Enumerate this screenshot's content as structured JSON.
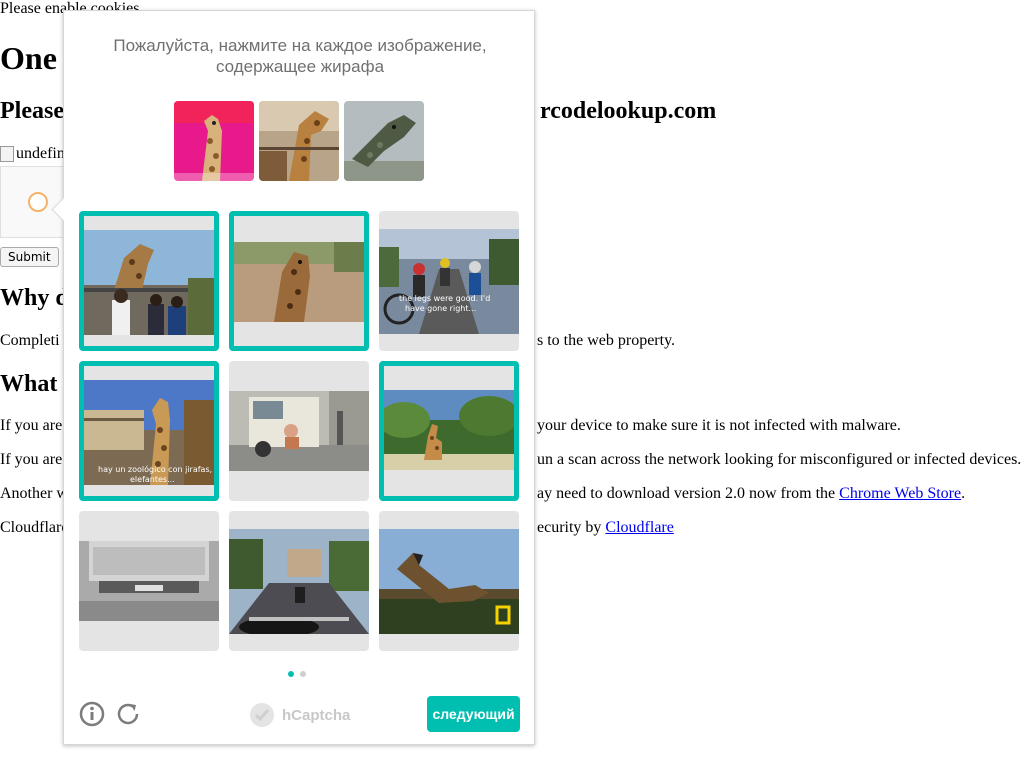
{
  "background_page": {
    "cookie_notice": "Please enable cookies.",
    "heading_one": "One",
    "heading_please": "Please",
    "heading_domain": "rcodelookup.com",
    "broken_image_alt": "undefin",
    "submit_label": "Submit",
    "heading_why": "Why d",
    "completing_start": "Completi",
    "completing_end": "s to the web property.",
    "heading_what": "What",
    "if_you_are_1_start": "If you are",
    "if_you_are_1_end": "your device to make sure it is not infected with malware.",
    "if_you_are_2_start": "If you are",
    "if_you_are_2_end": "un a scan across the network looking for misconfigured or infected devices.",
    "another_start": "Another w",
    "another_end": "ay need to download version 2.0 now from the",
    "chrome_store_link": "Chrome Web Store",
    "period": ".",
    "cloudflare_start": "Cloudflare",
    "cloudflare_end": "ecurity by",
    "cloudflare_link": "Cloudflare"
  },
  "challenge": {
    "prompt": "Пожалуйста, нажмите на каждое изображение, содержащее жирафа",
    "example_images": [
      "giraffe-pink-background",
      "giraffe-at-fence",
      "giraffe-head-close"
    ],
    "grid": [
      {
        "subject": "giraffe-feeding-crowd",
        "selected": true
      },
      {
        "subject": "giraffe-head-dirt",
        "selected": true
      },
      {
        "subject": "cyclists-road",
        "selected": false,
        "caption": "the legs were good. I'd have gone right..."
      },
      {
        "subject": "giraffe-enclosure",
        "selected": true,
        "caption": "hay un zoológico con jirafas, elefantes..."
      },
      {
        "subject": "garbage-truck-street",
        "selected": false
      },
      {
        "subject": "giraffe-trees",
        "selected": true
      },
      {
        "subject": "truck-rear",
        "selected": false
      },
      {
        "subject": "motorcycle-street",
        "selected": false
      },
      {
        "subject": "giraffe-head-sky",
        "selected": false
      }
    ],
    "page_dots": [
      true,
      false
    ],
    "brand": "hCaptcha",
    "next_label": "следующий",
    "accent_color": "#00bfb0"
  }
}
